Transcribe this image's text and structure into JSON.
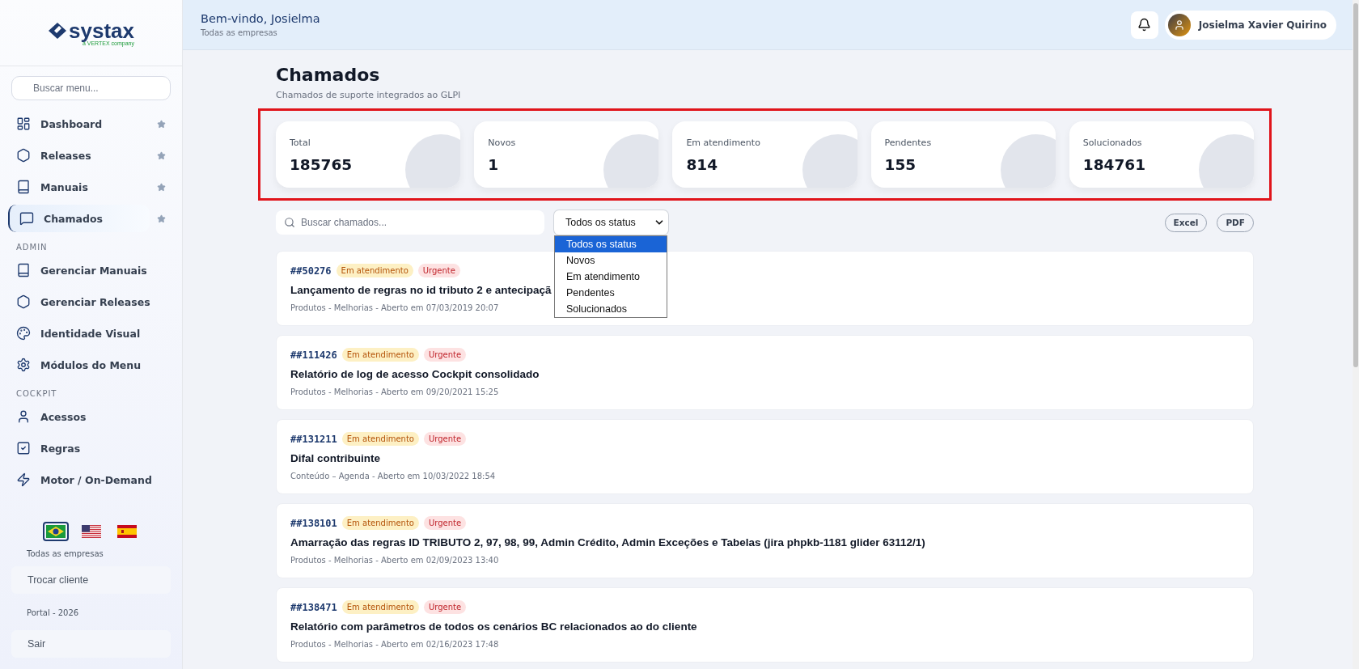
{
  "logo": {
    "name": "systax",
    "tagline": "a VERTEX company"
  },
  "sidebar": {
    "search": {
      "placeholder": "Buscar menu..."
    },
    "sections": [
      {
        "items": [
          {
            "label": "Dashboard",
            "selected": false,
            "starred": true
          },
          {
            "label": "Releases",
            "selected": false,
            "starred": true
          },
          {
            "label": "Manuais",
            "selected": false,
            "starred": true
          },
          {
            "label": "Chamados",
            "selected": true,
            "starred": true
          }
        ]
      },
      {
        "title": "ADMIN",
        "items": [
          {
            "label": "Gerenciar Manuais",
            "selected": false,
            "starred": false
          },
          {
            "label": "Gerenciar Releases",
            "selected": false,
            "starred": false
          },
          {
            "label": "Identidade Visual",
            "selected": false,
            "starred": false
          },
          {
            "label": "Módulos do Menu",
            "selected": false,
            "starred": false
          }
        ]
      },
      {
        "title": "COCKPIT",
        "items": [
          {
            "label": "Acessos",
            "selected": false,
            "starred": false
          },
          {
            "label": "Regras",
            "selected": false,
            "starred": false
          },
          {
            "label": "Motor / On-Demand",
            "selected": false,
            "starred": false
          }
        ]
      }
    ],
    "languages": [
      {
        "selected": true
      },
      {
        "selected": false
      },
      {
        "selected": false
      }
    ],
    "company": "Todas as empresas",
    "switch_button": "Trocar cliente",
    "version": "Portal - 2026",
    "logout_button": "Sair"
  },
  "header": {
    "greeting": "Bem-vindo, Josielma",
    "subtitle": "Todas as empresas",
    "user": "Josielma Xavier Quirino"
  },
  "page": {
    "title": "Chamados",
    "subtitle": "Chamados de suporte integrados ao GLPI"
  },
  "stats": [
    {
      "label": "Total",
      "value": "185765"
    },
    {
      "label": "Novos",
      "value": "1"
    },
    {
      "label": "Em atendimento",
      "value": "814"
    },
    {
      "label": "Pendentes",
      "value": "155"
    },
    {
      "label": "Solucionados",
      "value": "184761"
    }
  ],
  "search": {
    "placeholder": "Buscar chamados..."
  },
  "status_filter": {
    "value": "Todos os status",
    "expanded": true,
    "options": [
      {
        "label": "Todos os status",
        "selected": true
      },
      {
        "label": "Novos",
        "selected": false
      },
      {
        "label": "Em atendimento",
        "selected": false
      },
      {
        "label": "Pendentes",
        "selected": false
      },
      {
        "label": "Solucionados",
        "selected": false
      }
    ]
  },
  "export_buttons": [
    "Excel",
    "PDF"
  ],
  "tickets": [
    {
      "id": "##50276",
      "status": "Em atendimento",
      "priority": "Urgente",
      "title": "Lançamento de regras no id tributo 2 e antecipaçã",
      "meta": "Produtos - Melhorias - Aberto em 07/03/2019 20:07"
    },
    {
      "id": "##111426",
      "status": "Em atendimento",
      "priority": "Urgente",
      "title": "Relatório de log de acesso Cockpit consolidado",
      "meta": "Produtos - Melhorias - Aberto em 09/20/2021 15:25"
    },
    {
      "id": "##131211",
      "status": "Em atendimento",
      "priority": "Urgente",
      "title": "Difal contribuinte",
      "meta": "Conteúdo – Agenda - Aberto em 10/03/2022 18:54"
    },
    {
      "id": "##138101",
      "status": "Em atendimento",
      "priority": "Urgente",
      "title": "Amarração das regras ID TRIBUTO 2, 97, 98, 99, Admin Crédito, Admin Exceções e Tabelas (jira phpkb-1181 glider 63112/1)",
      "meta": "Produtos - Melhorias - Aberto em 02/09/2023 13:40"
    },
    {
      "id": "##138471",
      "status": "Em atendimento",
      "priority": "Urgente",
      "title": "Relatório com parâmetros de todos os cenários BC relacionados ao do cliente",
      "meta": "Produtos - Melhorias - Aberto em 02/16/2023 17:48"
    }
  ]
}
